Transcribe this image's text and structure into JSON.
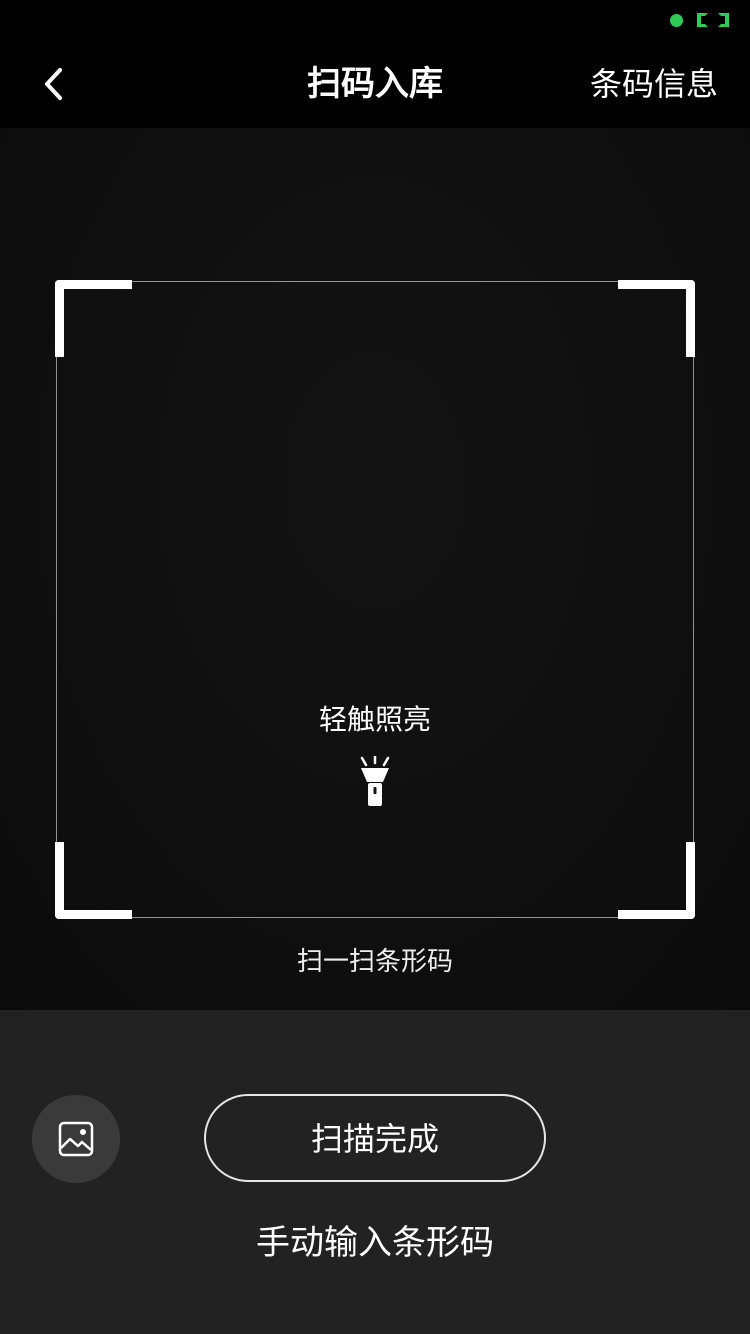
{
  "status_bar": {
    "indicator_color": "#2ecc55",
    "icons": [
      "status-dot-icon",
      "screen-cast-icon"
    ]
  },
  "nav": {
    "back_icon": "chevron-left-icon",
    "title": "扫码入库",
    "right_action": "条码信息"
  },
  "scanner": {
    "torch_label": "轻触照亮",
    "torch_icon": "flashlight-icon",
    "hint": "扫一扫条形码"
  },
  "bottom": {
    "album_icon": "image-icon",
    "done_label": "扫描完成",
    "manual_label": "手动输入条形码"
  },
  "colors": {
    "background": "#000000",
    "panel": "#222222",
    "album_button": "#3a3a3a",
    "accent_green": "#2ecc55"
  }
}
